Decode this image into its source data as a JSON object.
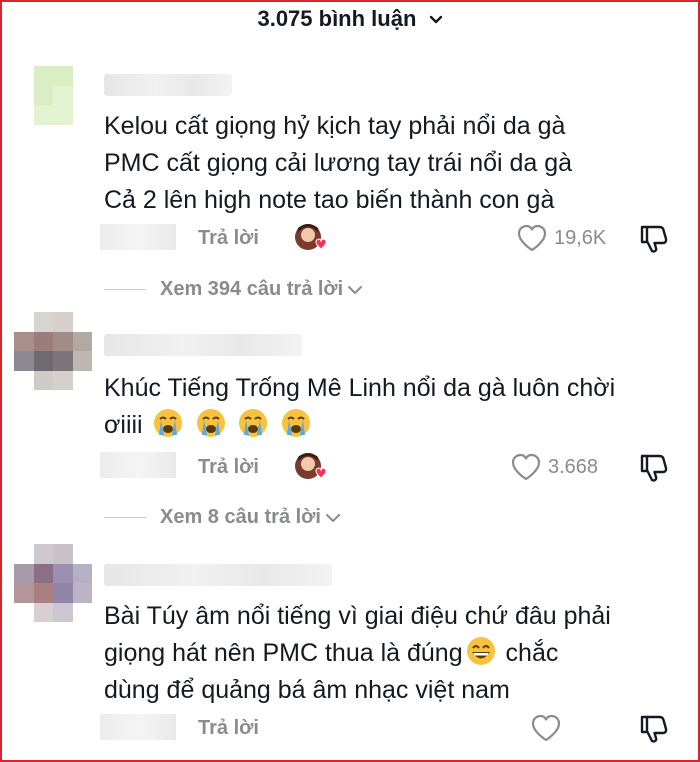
{
  "header": {
    "count_label": "3.075 bình luận",
    "icon": "chevron-down-icon"
  },
  "colors": {
    "frame_border": "#d9252e",
    "muted_text": "#8a8b91",
    "primary_text": "#161823",
    "heart_badge": "#fe2c55"
  },
  "comments": [
    {
      "text_lines": [
        "Kelou cất giọng hỷ kịch tay phải nổi da gà",
        "PMC cất giọng cải lương tay trái nổi da gà",
        "Cả 2 lên high note tao biến thành con gà"
      ],
      "reply_label": "Trả lời",
      "creator_liked": true,
      "like_count": "19,6K",
      "view_replies_label": "Xem 394 câu trả lời"
    },
    {
      "text_line1": "Khúc Tiếng Trống Mê Linh nổi da gà luôn chời",
      "text_line2": "ơiiii",
      "emojis": [
        "loudly-crying-face",
        "loudly-crying-face",
        "loudly-crying-face",
        "loudly-crying-face"
      ],
      "reply_label": "Trả lời",
      "creator_liked": true,
      "like_count": "3.668",
      "view_replies_label": "Xem 8 câu trả lời"
    },
    {
      "text_line1": "Bài Túy âm nổi tiếng vì giai điệu chứ đâu phải",
      "text_line2a": "giọng hát nên PMC thua là đúng",
      "text_line2b": " chắc",
      "text_line3": "dùng để quảng bá âm nhạc việt nam",
      "emoji": "grinning-face-with-smiling-eyes",
      "reply_label": "Trả lời",
      "like_count": ""
    }
  ]
}
